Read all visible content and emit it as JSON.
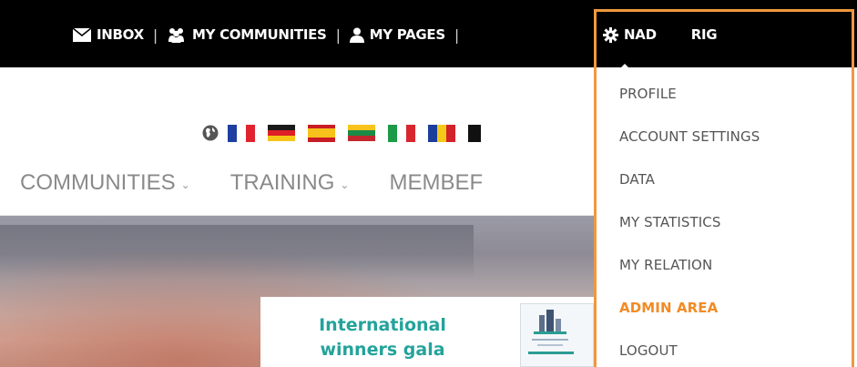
{
  "topbar": {
    "items": [
      {
        "label": "INBOX",
        "icon": "envelope-icon"
      },
      {
        "label": "MY COMMUNITIES",
        "icon": "users-icon"
      },
      {
        "label": "MY PAGES",
        "icon": "user-icon"
      }
    ],
    "separator": "|",
    "user": {
      "first": "NAD",
      "last": "RIG",
      "icon": "gear-icon"
    }
  },
  "languages": {
    "globe_icon": "globe-icon",
    "flags": [
      "French",
      "German",
      "Spanish",
      "Lithuanian",
      "Italian",
      "Romanian",
      "Belgian"
    ]
  },
  "main_nav": [
    {
      "label": "COMMUNITIES",
      "chevron": "⌄"
    },
    {
      "label": "TRAINING",
      "chevron": "⌄"
    },
    {
      "label": "MEMBEF",
      "chevron": ""
    }
  ],
  "hero": {
    "card_title_line1": "International",
    "card_title_line2": "winners gala"
  },
  "dropdown": {
    "items": [
      "PROFILE",
      "ACCOUNT SETTINGS",
      "DATA",
      "MY STATISTICS",
      "MY RELATION",
      "ADMIN AREA",
      "LOGOUT"
    ],
    "active": "ADMIN AREA"
  },
  "colors": {
    "topbar": "#000000",
    "highlight_border": "#f0983e",
    "active_item": "#f28b24",
    "card_title": "#23a39b",
    "nav_text": "#8a8a8a"
  }
}
